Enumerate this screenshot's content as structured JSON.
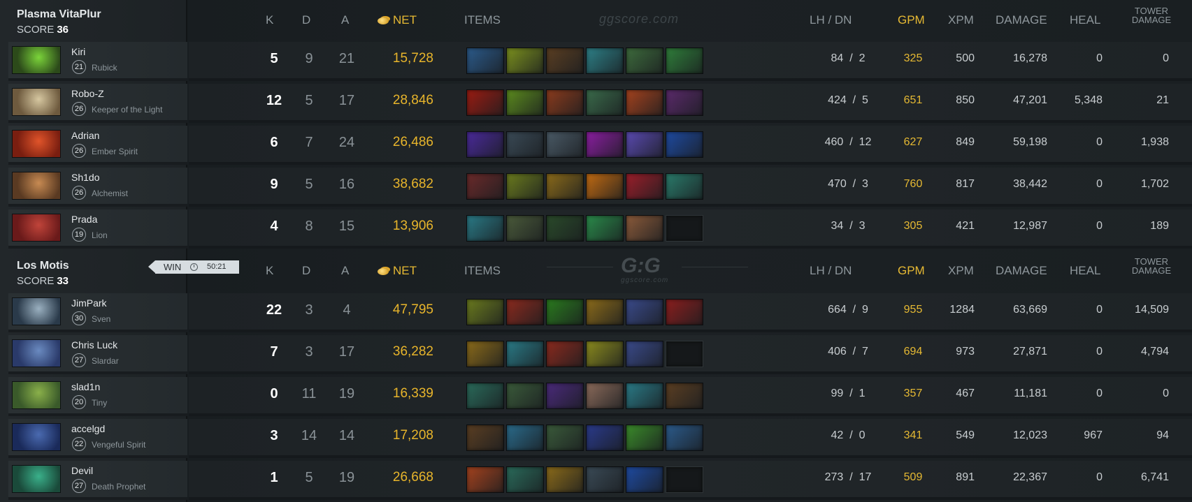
{
  "headers": {
    "k": "K",
    "d": "D",
    "a": "A",
    "net": "NET",
    "items": "ITEMS",
    "lh_dn": "LH  /  DN",
    "gpm": "GPM",
    "xpm": "XPM",
    "damage": "DAMAGE",
    "heal": "HEAL",
    "tower_line1": "TOWER",
    "tower_line2": "DAMAGE"
  },
  "watermark_top": "ggscore.com",
  "watermark_logo": "G:G",
  "watermark_sub": "ggscore.com",
  "match": {
    "result": "WIN",
    "duration": "50:21"
  },
  "teams": [
    {
      "name": "Plasma VitaPlur",
      "score_label": "SCORE",
      "score": "36",
      "players": [
        {
          "name": "Kiri",
          "level": "21",
          "hero": "Rubick",
          "avatar_colors": [
            "#2c4a1a",
            "#7bd43a"
          ],
          "k": "5",
          "d": "9",
          "a": "21",
          "net": "15,728",
          "items": [
            "#2b5a8a",
            "#7a8f1e",
            "#5a3e22",
            "#2d7f86",
            "#3d6a3c",
            "#2f7d3a"
          ],
          "lh": "84",
          "dn": "2",
          "gpm": "325",
          "xpm": "500",
          "damage": "16,278",
          "heal": "0",
          "tower": "0"
        },
        {
          "name": "Robo-Z",
          "level": "26",
          "hero": "Keeper of the Light",
          "avatar_colors": [
            "#6e5a3e",
            "#d6c7a0"
          ],
          "k": "12",
          "d": "5",
          "a": "17",
          "net": "28,846",
          "items": [
            "#9a1c12",
            "#5b8a1e",
            "#8a3b1d",
            "#3a6a4a",
            "#a3421e",
            "#5a2a6a"
          ],
          "lh": "424",
          "dn": "5",
          "gpm": "651",
          "xpm": "850",
          "damage": "47,201",
          "heal": "5,348",
          "tower": "21"
        },
        {
          "name": "Adrian",
          "level": "26",
          "hero": "Ember Spirit",
          "avatar_colors": [
            "#7a1e10",
            "#e0542a"
          ],
          "k": "6",
          "d": "7",
          "a": "24",
          "net": "26,486",
          "items": [
            "#4a2a9a",
            "#3a4a56",
            "#4a5a66",
            "#8a1ea0",
            "#5a4ab0",
            "#1e4aa0"
          ],
          "lh": "460",
          "dn": "12",
          "gpm": "627",
          "xpm": "849",
          "damage": "59,198",
          "heal": "0",
          "tower": "1,938"
        },
        {
          "name": "Sh1do",
          "level": "26",
          "hero": "Alchemist",
          "avatar_colors": [
            "#5a3a22",
            "#c78a52"
          ],
          "k": "9",
          "d": "5",
          "a": "16",
          "net": "38,682",
          "items": [
            "#6a2a2a",
            "#6a7a1e",
            "#8a6a1a",
            "#c06a12",
            "#9a1e2a",
            "#2a7a6a"
          ],
          "lh": "470",
          "dn": "3",
          "gpm": "760",
          "xpm": "817",
          "damage": "38,442",
          "heal": "0",
          "tower": "1,702"
        },
        {
          "name": "Prada",
          "level": "19",
          "hero": "Lion",
          "avatar_colors": [
            "#6a1a1a",
            "#c0443a"
          ],
          "k": "4",
          "d": "8",
          "a": "15",
          "net": "13,906",
          "items": [
            "#2a7a86",
            "#4a5a3a",
            "#2a4a2a",
            "#2a8a4a",
            "#8a5a3a",
            ""
          ],
          "lh": "34",
          "dn": "3",
          "gpm": "305",
          "xpm": "421",
          "damage": "12,987",
          "heal": "0",
          "tower": "189"
        }
      ]
    },
    {
      "name": "Los Motis",
      "score_label": "SCORE",
      "score": "33",
      "players": [
        {
          "name": "JimPark",
          "level": "30",
          "hero": "Sven",
          "avatar_colors": [
            "#2a3a4a",
            "#9ab0c0"
          ],
          "k": "22",
          "d": "3",
          "a": "4",
          "net": "47,795",
          "items": [
            "#6a7a1e",
            "#8a2a1e",
            "#2a7a1e",
            "#8a6a1a",
            "#3a4a8a",
            "#8a1e1e"
          ],
          "lh": "664",
          "dn": "9",
          "gpm": "955",
          "xpm": "1284",
          "damage": "63,669",
          "heal": "0",
          "tower": "14,509"
        },
        {
          "name": "Chris Luck",
          "level": "27",
          "hero": "Slardar",
          "avatar_colors": [
            "#2a3a6a",
            "#6a8ac0"
          ],
          "k": "7",
          "d": "3",
          "a": "17",
          "net": "36,282",
          "items": [
            "#8a6a1a",
            "#2a7a86",
            "#8a2a1e",
            "#8a8a1e",
            "#3a4a8a",
            ""
          ],
          "lh": "406",
          "dn": "7",
          "gpm": "694",
          "xpm": "973",
          "damage": "27,871",
          "heal": "0",
          "tower": "4,794"
        },
        {
          "name": "slad1n",
          "level": "20",
          "hero": "Tiny",
          "avatar_colors": [
            "#3a5a2a",
            "#8ab04a"
          ],
          "k": "0",
          "d": "11",
          "a": "19",
          "net": "16,339",
          "items": [
            "#2a6a5a",
            "#3a5a3a",
            "#4a2a7a",
            "#8a6a5a",
            "#2a7a86",
            "#5a3e22"
          ],
          "lh": "99",
          "dn": "1",
          "gpm": "357",
          "xpm": "467",
          "damage": "11,181",
          "heal": "0",
          "tower": "0"
        },
        {
          "name": "accelgd",
          "level": "22",
          "hero": "Vengeful Spirit",
          "avatar_colors": [
            "#1a2a5a",
            "#4a6ab0"
          ],
          "k": "3",
          "d": "14",
          "a": "14",
          "net": "17,208",
          "items": [
            "#5a3e22",
            "#2a6a8a",
            "#3a5a3a",
            "#2a3a8a",
            "#3a8a2a",
            "#2b5a8a"
          ],
          "lh": "42",
          "dn": "0",
          "gpm": "341",
          "xpm": "549",
          "damage": "12,023",
          "heal": "967",
          "tower": "94"
        },
        {
          "name": "Devil",
          "level": "27",
          "hero": "Death Prophet",
          "avatar_colors": [
            "#1a4a3a",
            "#3ab08a"
          ],
          "k": "1",
          "d": "5",
          "a": "19",
          "net": "26,668",
          "items": [
            "#a3421e",
            "#2a6a5a",
            "#8a6a1a",
            "#3a4a56",
            "#1e4aa0",
            ""
          ],
          "lh": "273",
          "dn": "17",
          "gpm": "509",
          "xpm": "891",
          "damage": "22,367",
          "heal": "0",
          "tower": "6,741"
        }
      ]
    }
  ]
}
